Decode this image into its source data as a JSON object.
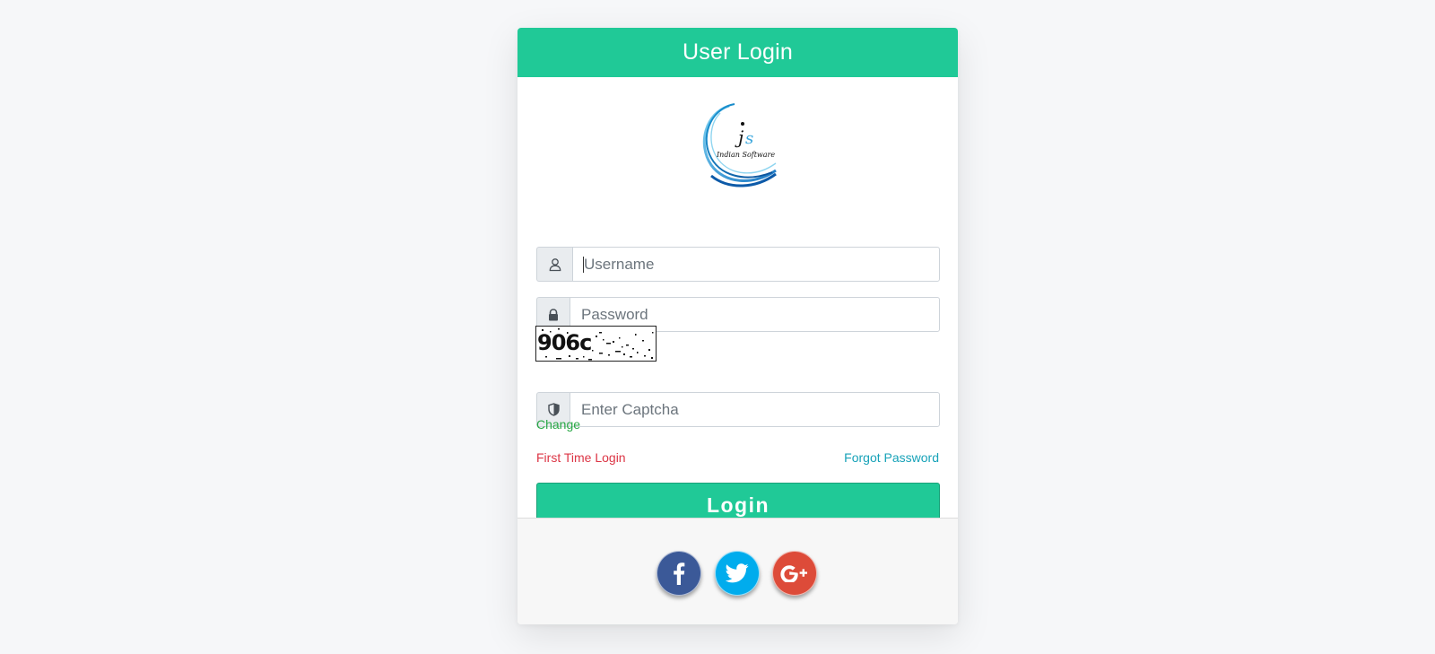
{
  "card": {
    "title": "User Login"
  },
  "logo": {
    "icon": "indian-software-logo",
    "text": "Indian Software"
  },
  "form": {
    "username": {
      "placeholder": "Username",
      "value": "",
      "icon": "user-icon"
    },
    "password": {
      "placeholder": "Password",
      "value": "",
      "icon": "lock-icon"
    },
    "captcha": {
      "image_text": "906c",
      "placeholder": "Enter Captcha",
      "value": "",
      "icon": "shield-icon"
    },
    "change_label": "Change",
    "first_time_login_label": "First Time Login",
    "forgot_password_label": "Forgot Password",
    "login_label": "Login"
  },
  "social": [
    {
      "name": "facebook",
      "icon": "facebook-icon",
      "color": "#3b5998"
    },
    {
      "name": "twitter",
      "icon": "twitter-icon",
      "color": "#00aced"
    },
    {
      "name": "google-plus",
      "icon": "google-plus-icon",
      "color": "#dd4b39"
    }
  ],
  "colors": {
    "accent": "#20c997",
    "page_background": "#f6f7f9",
    "change_link": "#28a745",
    "first_time_link": "#dc3545",
    "forgot_link": "#17a2b8"
  }
}
